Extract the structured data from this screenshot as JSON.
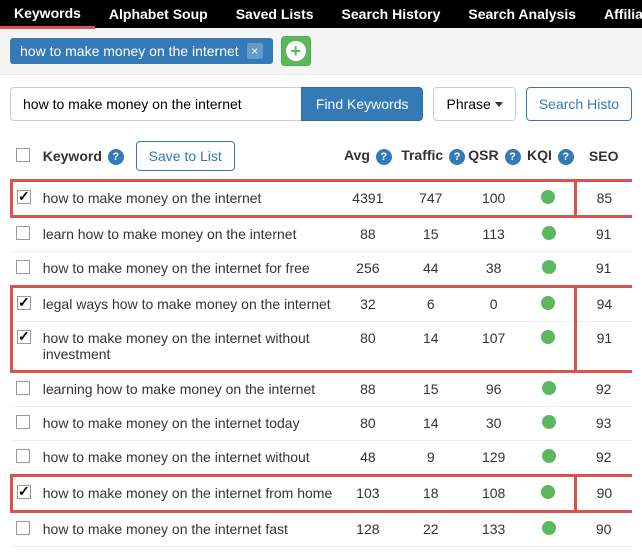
{
  "nav": {
    "items": [
      {
        "label": "Keywords",
        "active": true
      },
      {
        "label": "Alphabet Soup"
      },
      {
        "label": "Saved Lists"
      },
      {
        "label": "Search History"
      },
      {
        "label": "Search Analysis"
      },
      {
        "label": "Affiliate P"
      }
    ]
  },
  "chip": {
    "text": "how to make money on the internet"
  },
  "search": {
    "value": "how to make money on the internet",
    "findLabel": "Find Keywords",
    "matchLabel": "Phrase",
    "historyLabel": "Search Histo"
  },
  "headers": {
    "keyword": "Keyword",
    "saveList": "Save to List",
    "avg": "Avg",
    "traffic": "Traffic",
    "qsr": "QSR",
    "kqi": "KQI",
    "seo": "SEO"
  },
  "rows": [
    {
      "checked": true,
      "kw": "how to make money on the internet",
      "avg": 4391,
      "traffic": 747,
      "qsr": 100,
      "kqi": "green",
      "seo": 85,
      "group": 1,
      "first": true,
      "last": true
    },
    {
      "checked": false,
      "kw": "learn how to make money on the internet",
      "avg": 88,
      "traffic": 15,
      "qsr": 113,
      "kqi": "green",
      "seo": 91
    },
    {
      "checked": false,
      "kw": "how to make money on the internet for free",
      "avg": 256,
      "traffic": 44,
      "qsr": 38,
      "kqi": "green",
      "seo": 91
    },
    {
      "checked": true,
      "kw": "legal ways how to make money on the internet",
      "avg": 32,
      "traffic": 6,
      "qsr": 0,
      "kqi": "green",
      "seo": 94,
      "group": 2,
      "first": true
    },
    {
      "checked": true,
      "kw": "how to make money on the internet without investment",
      "avg": 80,
      "traffic": 14,
      "qsr": 107,
      "kqi": "green",
      "seo": 91,
      "group": 2,
      "last": true
    },
    {
      "checked": false,
      "kw": "learning how to make money on the internet",
      "avg": 88,
      "traffic": 15,
      "qsr": 96,
      "kqi": "green",
      "seo": 92
    },
    {
      "checked": false,
      "kw": "how to make money on the internet today",
      "avg": 80,
      "traffic": 14,
      "qsr": 30,
      "kqi": "green",
      "seo": 93
    },
    {
      "checked": false,
      "kw": "how to make money on the internet without",
      "avg": 48,
      "traffic": 9,
      "qsr": 129,
      "kqi": "green",
      "seo": 92
    },
    {
      "checked": true,
      "kw": "how to make money on the internet from home",
      "avg": 103,
      "traffic": 18,
      "qsr": 108,
      "kqi": "green",
      "seo": 90,
      "group": 3,
      "first": true,
      "last": true
    },
    {
      "checked": false,
      "kw": "how to make money on the internet fast",
      "avg": 128,
      "traffic": 22,
      "qsr": 133,
      "kqi": "green",
      "seo": 90
    }
  ]
}
